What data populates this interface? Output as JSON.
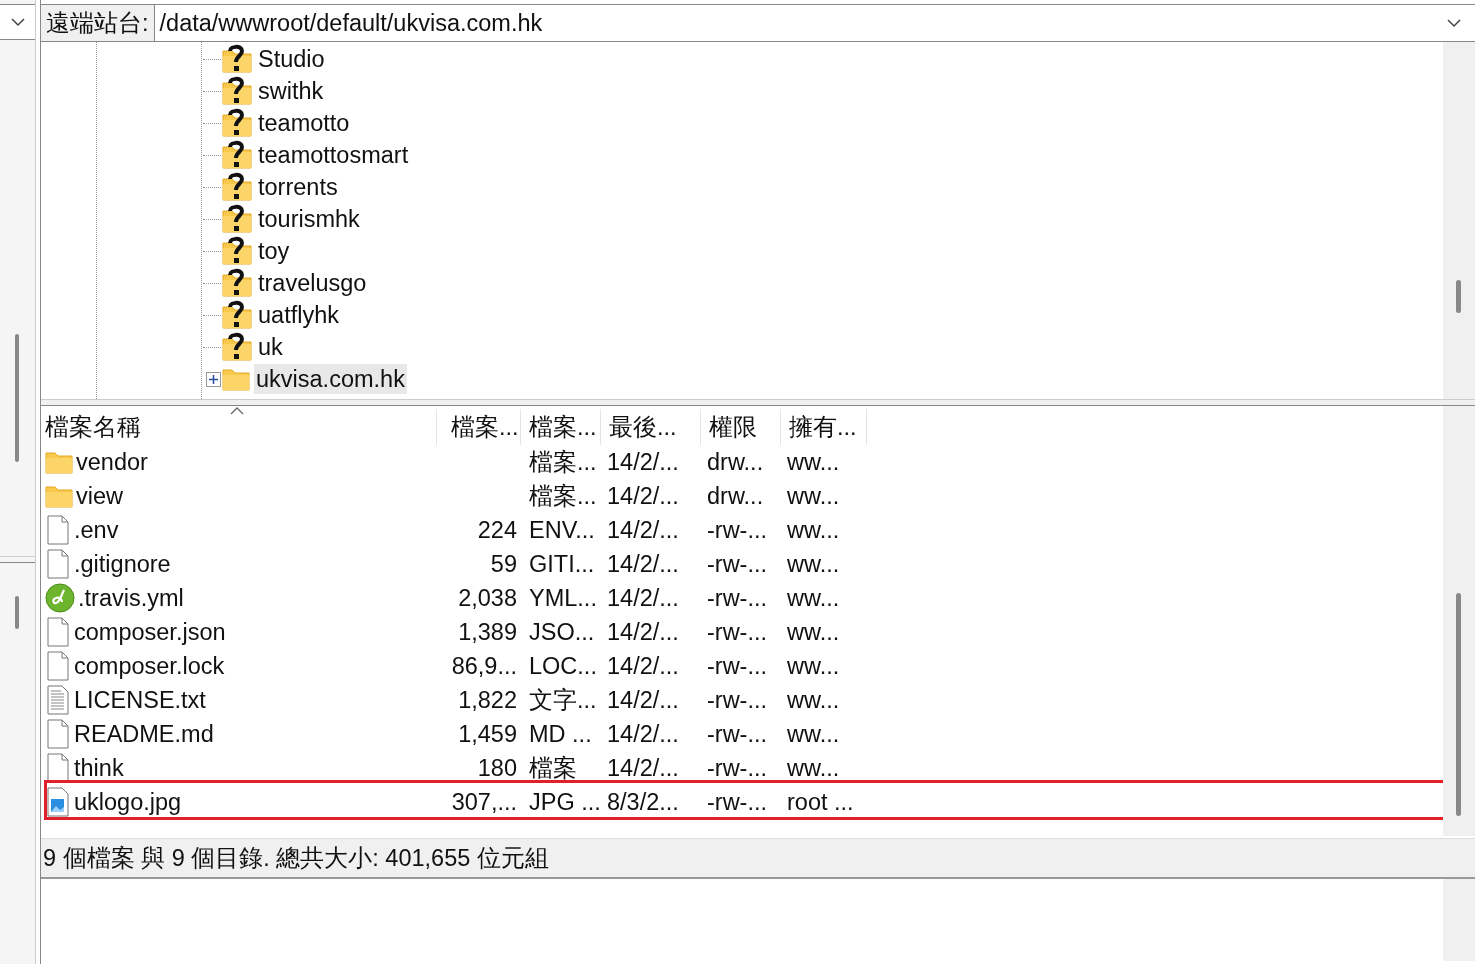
{
  "address_bar": {
    "label": "遠端站台:",
    "value": "/data/wwwroot/default/ukvisa.com.hk"
  },
  "tree": {
    "items": [
      {
        "label": "Studio",
        "kind": "unknown",
        "expandable": false,
        "selected": false
      },
      {
        "label": "swithk",
        "kind": "unknown",
        "expandable": false,
        "selected": false
      },
      {
        "label": "teamotto",
        "kind": "unknown",
        "expandable": false,
        "selected": false
      },
      {
        "label": "teamottosmart",
        "kind": "unknown",
        "expandable": false,
        "selected": false
      },
      {
        "label": "torrents",
        "kind": "unknown",
        "expandable": false,
        "selected": false
      },
      {
        "label": "tourismhk",
        "kind": "unknown",
        "expandable": false,
        "selected": false
      },
      {
        "label": "toy",
        "kind": "unknown",
        "expandable": false,
        "selected": false
      },
      {
        "label": "travelusgo",
        "kind": "unknown",
        "expandable": false,
        "selected": false
      },
      {
        "label": "uatflyhk",
        "kind": "unknown",
        "expandable": false,
        "selected": false
      },
      {
        "label": "uk",
        "kind": "unknown",
        "expandable": false,
        "selected": false
      },
      {
        "label": "ukvisa.com.hk",
        "kind": "folder",
        "expandable": true,
        "selected": true
      }
    ]
  },
  "file_list": {
    "columns": [
      {
        "label": "檔案名稱",
        "sorted": true
      },
      {
        "label": "檔案...",
        "sorted": false
      },
      {
        "label": "檔案...",
        "sorted": false
      },
      {
        "label": "最後...",
        "sorted": false
      },
      {
        "label": "權限",
        "sorted": false
      },
      {
        "label": "擁有...",
        "sorted": false
      }
    ],
    "rows": [
      {
        "kind": "folder",
        "name": "vendor",
        "type": "檔案...",
        "modified": "14/2/...",
        "permissions": "drw...",
        "owner": "ww...",
        "highlighted": false
      },
      {
        "kind": "folder",
        "name": "view",
        "type": "檔案...",
        "modified": "14/2/...",
        "permissions": "drw...",
        "owner": "ww...",
        "highlighted": false
      },
      {
        "kind": "file",
        "name": ".env",
        "size": "224",
        "type": "ENV...",
        "modified": "14/2/...",
        "permissions": "-rw-...",
        "owner": "ww...",
        "highlighted": false
      },
      {
        "kind": "file",
        "name": ".gitignore",
        "size": "59",
        "type": "GITI...",
        "modified": "14/2/...",
        "permissions": "-rw-...",
        "owner": "ww...",
        "highlighted": false
      },
      {
        "kind": "dreamweaver",
        "name": ".travis.yml",
        "size": "2,038",
        "type": "YML...",
        "modified": "14/2/...",
        "permissions": "-rw-...",
        "owner": "ww...",
        "highlighted": false
      },
      {
        "kind": "file",
        "name": "composer.json",
        "size": "1,389",
        "type": "JSO...",
        "modified": "14/2/...",
        "permissions": "-rw-...",
        "owner": "ww...",
        "highlighted": false
      },
      {
        "kind": "file",
        "name": "composer.lock",
        "size": "86,9...",
        "type": "LOC...",
        "modified": "14/2/...",
        "permissions": "-rw-...",
        "owner": "ww...",
        "highlighted": false
      },
      {
        "kind": "text",
        "name": "LICENSE.txt",
        "size": "1,822",
        "type": "文字...",
        "modified": "14/2/...",
        "permissions": "-rw-...",
        "owner": "ww...",
        "highlighted": false
      },
      {
        "kind": "file",
        "name": "README.md",
        "size": "1,459",
        "type": "MD ...",
        "modified": "14/2/...",
        "permissions": "-rw-...",
        "owner": "ww...",
        "highlighted": false
      },
      {
        "kind": "file",
        "name": "think",
        "size": "180",
        "type": "檔案",
        "modified": "14/2/...",
        "permissions": "-rw-...",
        "owner": "ww...",
        "highlighted": false
      },
      {
        "kind": "image",
        "name": "uklogo.jpg",
        "size": "307,...",
        "type": "JPG ...",
        "modified": "8/3/2...",
        "permissions": "-rw-...",
        "owner": "root ...",
        "highlighted": true
      }
    ]
  },
  "status_bar": {
    "text": "9 個檔案 與 9 個目錄. 總共大小: 401,655 位元組"
  }
}
